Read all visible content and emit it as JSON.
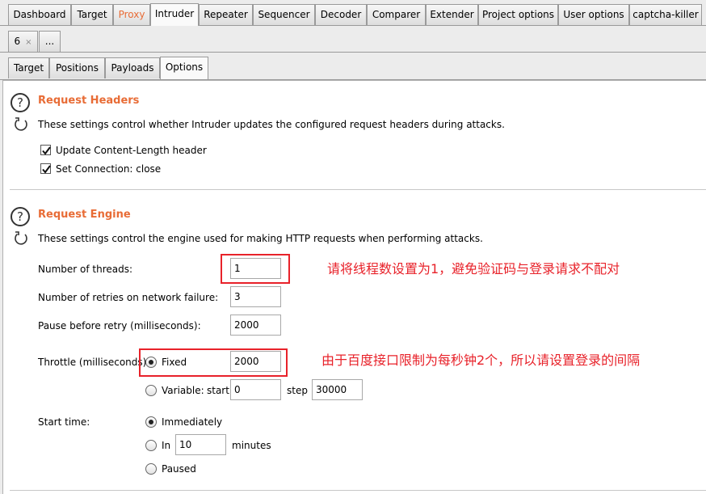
{
  "main_tabs": [
    {
      "label": "Dashboard"
    },
    {
      "label": "Target"
    },
    {
      "label": "Proxy"
    },
    {
      "label": "Intruder"
    },
    {
      "label": "Repeater"
    },
    {
      "label": "Sequencer"
    },
    {
      "label": "Decoder"
    },
    {
      "label": "Comparer"
    },
    {
      "label": "Extender"
    },
    {
      "label": "Project options"
    },
    {
      "label": "User options"
    },
    {
      "label": "captcha-killer"
    }
  ],
  "selected_main_tab": "Intruder",
  "attack_tabs": [
    {
      "label": "6",
      "close": "×"
    },
    {
      "label": "..."
    }
  ],
  "sub_tabs": [
    {
      "label": "Target"
    },
    {
      "label": "Positions"
    },
    {
      "label": "Payloads"
    },
    {
      "label": "Options"
    }
  ],
  "selected_sub_tab": "Options",
  "request_headers": {
    "title": "Request Headers",
    "description": "These settings control whether Intruder updates the configured request headers during attacks.",
    "checkboxes": [
      {
        "label": "Update Content-Length header",
        "checked": true
      },
      {
        "label": "Set Connection: close",
        "checked": true
      }
    ]
  },
  "request_engine": {
    "title": "Request Engine",
    "description": "These settings control the engine used for making HTTP requests when performing attacks.",
    "threads_label": "Number of threads:",
    "threads_value": "1",
    "retries_label": "Number of retries on network failure:",
    "retries_value": "3",
    "pause_label": "Pause before retry (milliseconds):",
    "pause_value": "2000",
    "throttle_label": "Throttle (milliseconds):",
    "throttle_fixed_label": "Fixed",
    "throttle_fixed_value": "2000",
    "throttle_fixed_selected": true,
    "throttle_variable_label": "Variable:",
    "throttle_start_label": "start",
    "throttle_start_value": "0",
    "throttle_step_label": "step",
    "throttle_step_value": "30000",
    "start_time_label": "Start time:",
    "start_immediately_label": "Immediately",
    "start_in_label": "In",
    "start_in_value": "10",
    "start_minutes_label": "minutes",
    "start_paused_label": "Paused",
    "start_selected": "Immediately"
  },
  "annotations": {
    "note_threads": "请将线程数设置为1，避免验证码与登录请求不配对",
    "note_throttle": "由于百度接口限制为每秒钟2个，所以请设置登录的间隔",
    "color": "#e8222a"
  },
  "colors": {
    "section_title": "#e86c36",
    "proxy_tab": "#e86c36"
  }
}
